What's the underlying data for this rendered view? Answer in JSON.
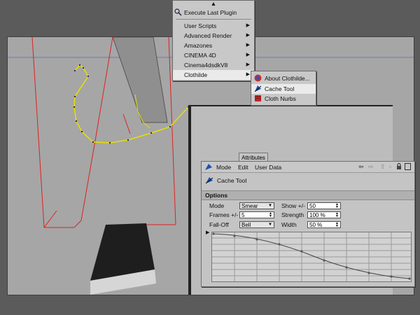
{
  "plugin_menu": {
    "execute_last": "Execute Last Plugin",
    "items": [
      "User Scripts",
      "Advanced Render",
      "Amazones",
      "CINEMA 4D",
      "Cinema4dsdkV8",
      "Clothilde"
    ]
  },
  "clothilde_submenu": {
    "items": [
      "About Clothilde...",
      "Cache Tool",
      "Cloth Nurbs"
    ]
  },
  "attributes": {
    "tab_label": "Attributes",
    "menubar": [
      "Mode",
      "Edit",
      "User Data"
    ],
    "object_name": "Cache Tool",
    "section_title": "Options",
    "mode_label": "Mode",
    "mode_value": "Smear",
    "show_label": "Show +/-",
    "show_value": "50",
    "frames_label": "Frames +/-",
    "frames_value": "5",
    "strength_label": "Strength",
    "strength_value": "100 %",
    "falloff_label": "Fall-Off",
    "falloff_value": "Bell",
    "width_label": "Width",
    "width_value": "50 %"
  },
  "colors": {
    "spline": "#e6e000",
    "bounding_box": "#e02020",
    "horizon": "#6b77c9",
    "menu_highlight": "#eaeaea"
  }
}
